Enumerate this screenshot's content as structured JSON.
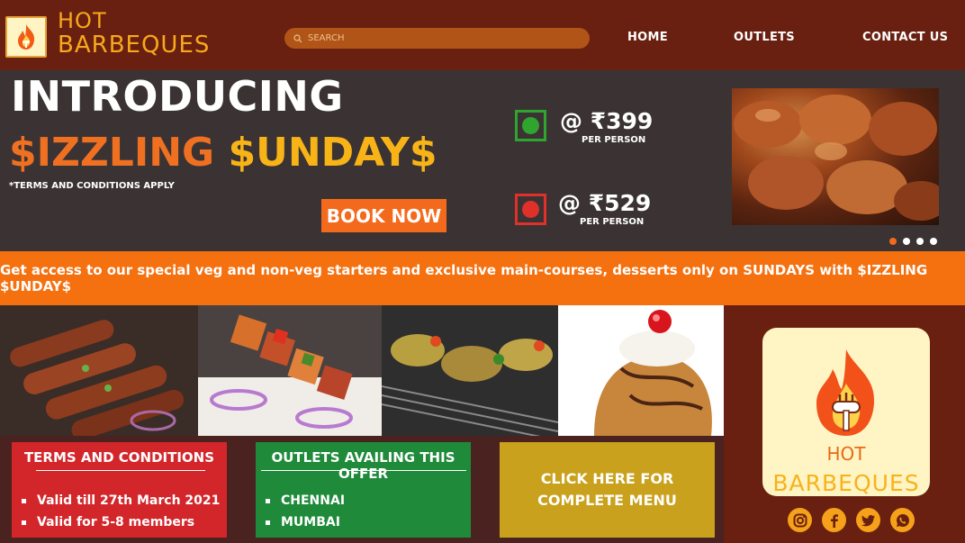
{
  "header": {
    "brand_line1": "HOT",
    "brand_line2": "BARBEQUES",
    "search_placeholder": "SEARCH",
    "nav": [
      {
        "label": "HOME"
      },
      {
        "label": "OUTLETS"
      },
      {
        "label": "CONTACT US"
      }
    ]
  },
  "hero": {
    "title": "INTRODUCING",
    "subtitle_part1": "$IZZLING",
    "subtitle_part2": "$UNDAY$",
    "terms_note": "*TERMS AND CONDITIONS APPLY",
    "book_label": "BOOK NOW",
    "prices": [
      {
        "type": "veg",
        "amount": "@ ₹399",
        "per": "PER PERSON",
        "color": "#2fa52f"
      },
      {
        "type": "non-veg",
        "amount": "@ ₹529",
        "per": "PER PERSON",
        "color": "#e0302a"
      }
    ],
    "carousel": {
      "slides": 4,
      "active": 0
    }
  },
  "banner": {
    "text": "Get access to our special veg and non-veg starters and exclusive main-courses, desserts only on SUNDAYS with $IZZLING $UNDAY$"
  },
  "food_images": [
    "seekh-kebab",
    "paneer-tikka",
    "grilled-vegetables",
    "dessert-sundae"
  ],
  "info": {
    "terms": {
      "title": "TERMS AND CONDITIONS",
      "items": [
        "Valid till 27th March 2021",
        "Valid for 5-8 members"
      ]
    },
    "outlets": {
      "title": "OUTLETS AVAILING THIS OFFER",
      "items": [
        "CHENNAI",
        "MUMBAI"
      ]
    },
    "menu": {
      "line1": "CLICK HERE FOR",
      "line2": "COMPLETE MENU"
    }
  },
  "side_logo": {
    "line1": "HOT",
    "line2": "BARBEQUES"
  },
  "socials": [
    "instagram-icon",
    "facebook-icon",
    "twitter-icon",
    "whatsapp-icon"
  ],
  "colors": {
    "brand_orange": "#f5700f",
    "header_bg": "#6a2010",
    "hero_bg": "#3b3333",
    "gold": "#f7a81b"
  }
}
